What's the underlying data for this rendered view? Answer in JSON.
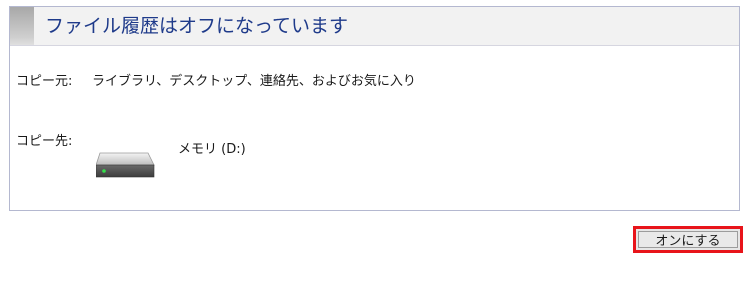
{
  "header": {
    "title": "ファイル履歴はオフになっています"
  },
  "source": {
    "label": "コピー元:",
    "value": "ライブラリ、デスクトップ、連絡先、およびお気に入り"
  },
  "destination": {
    "label": "コピー先:",
    "drive_icon": "drive-icon",
    "drive_name": "メモリ (D:)"
  },
  "actions": {
    "turn_on_label": "オンにする",
    "highlight_color": "#e8141a"
  },
  "colors": {
    "title": "#1e3a8a",
    "panel_border": "#b4b8d0"
  }
}
